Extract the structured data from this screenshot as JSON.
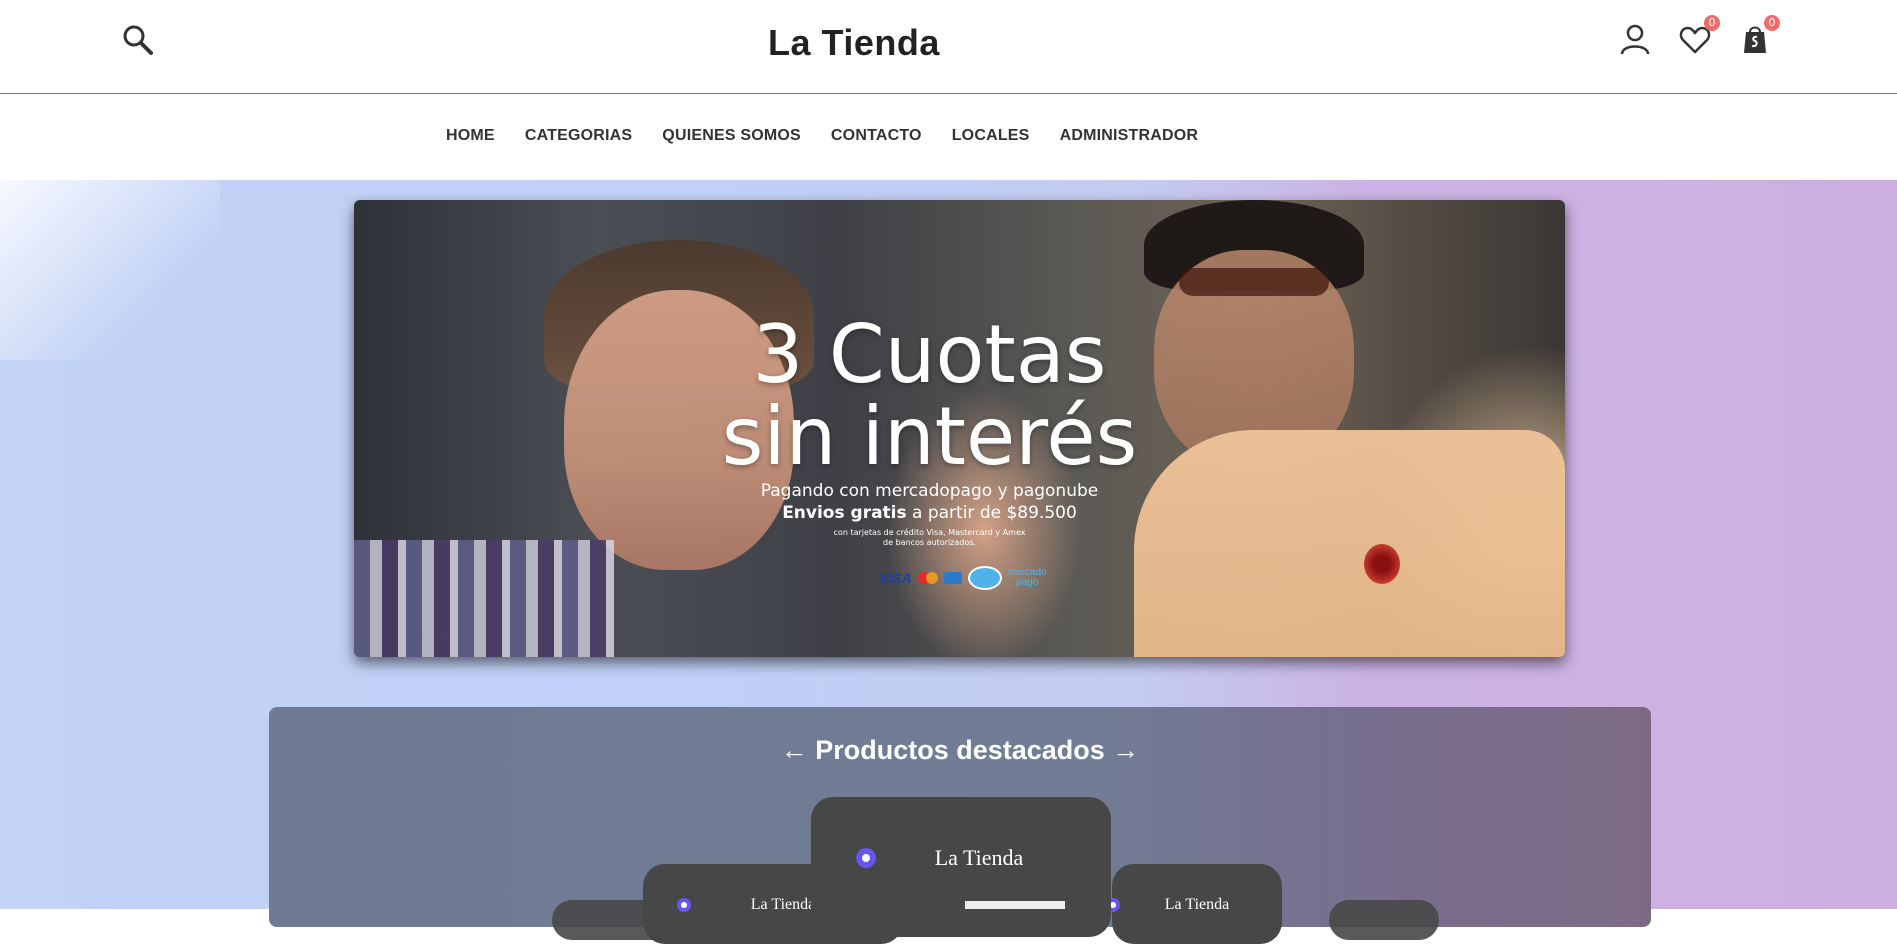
{
  "header": {
    "brand": "La Tienda",
    "icons": {
      "search": "search-icon",
      "user": "user-icon",
      "wishlist": "heart-icon",
      "cart": "shopping-bag-icon"
    },
    "wishlist_count": "0",
    "cart_count": "0"
  },
  "nav": {
    "items": [
      {
        "label": "HOME"
      },
      {
        "label": "CATEGORIAS"
      },
      {
        "label": "QUIENES SOMOS"
      },
      {
        "label": "CONTACTO"
      },
      {
        "label": "LOCALES"
      },
      {
        "label": "ADMINISTRADOR"
      }
    ]
  },
  "banner": {
    "headline_line1": "3 Cuotas",
    "headline_line2": "sin interés",
    "subline1": "Pagando con mercadopago y pagonube",
    "subline2_bold": "Envios gratis",
    "subline2_rest": " a partir de $89.500",
    "fineprint_line1": "con tarjetas de crédito Visa, Mastercard y Amex",
    "fineprint_line2": "de bancos autorizados.",
    "payment": {
      "visa": "VISA",
      "mercadopago_line1": "mercado",
      "mercadopago_line2": "pago"
    }
  },
  "products": {
    "title": "← Productos destacados →",
    "cards": [
      {
        "brand": "La Tienda"
      },
      {
        "brand": "La Tienda"
      },
      {
        "brand": "La Tienda"
      }
    ]
  },
  "colors": {
    "badge": "#f06a6a",
    "card_dot": "#6655f0",
    "card_bg": "#474747"
  }
}
